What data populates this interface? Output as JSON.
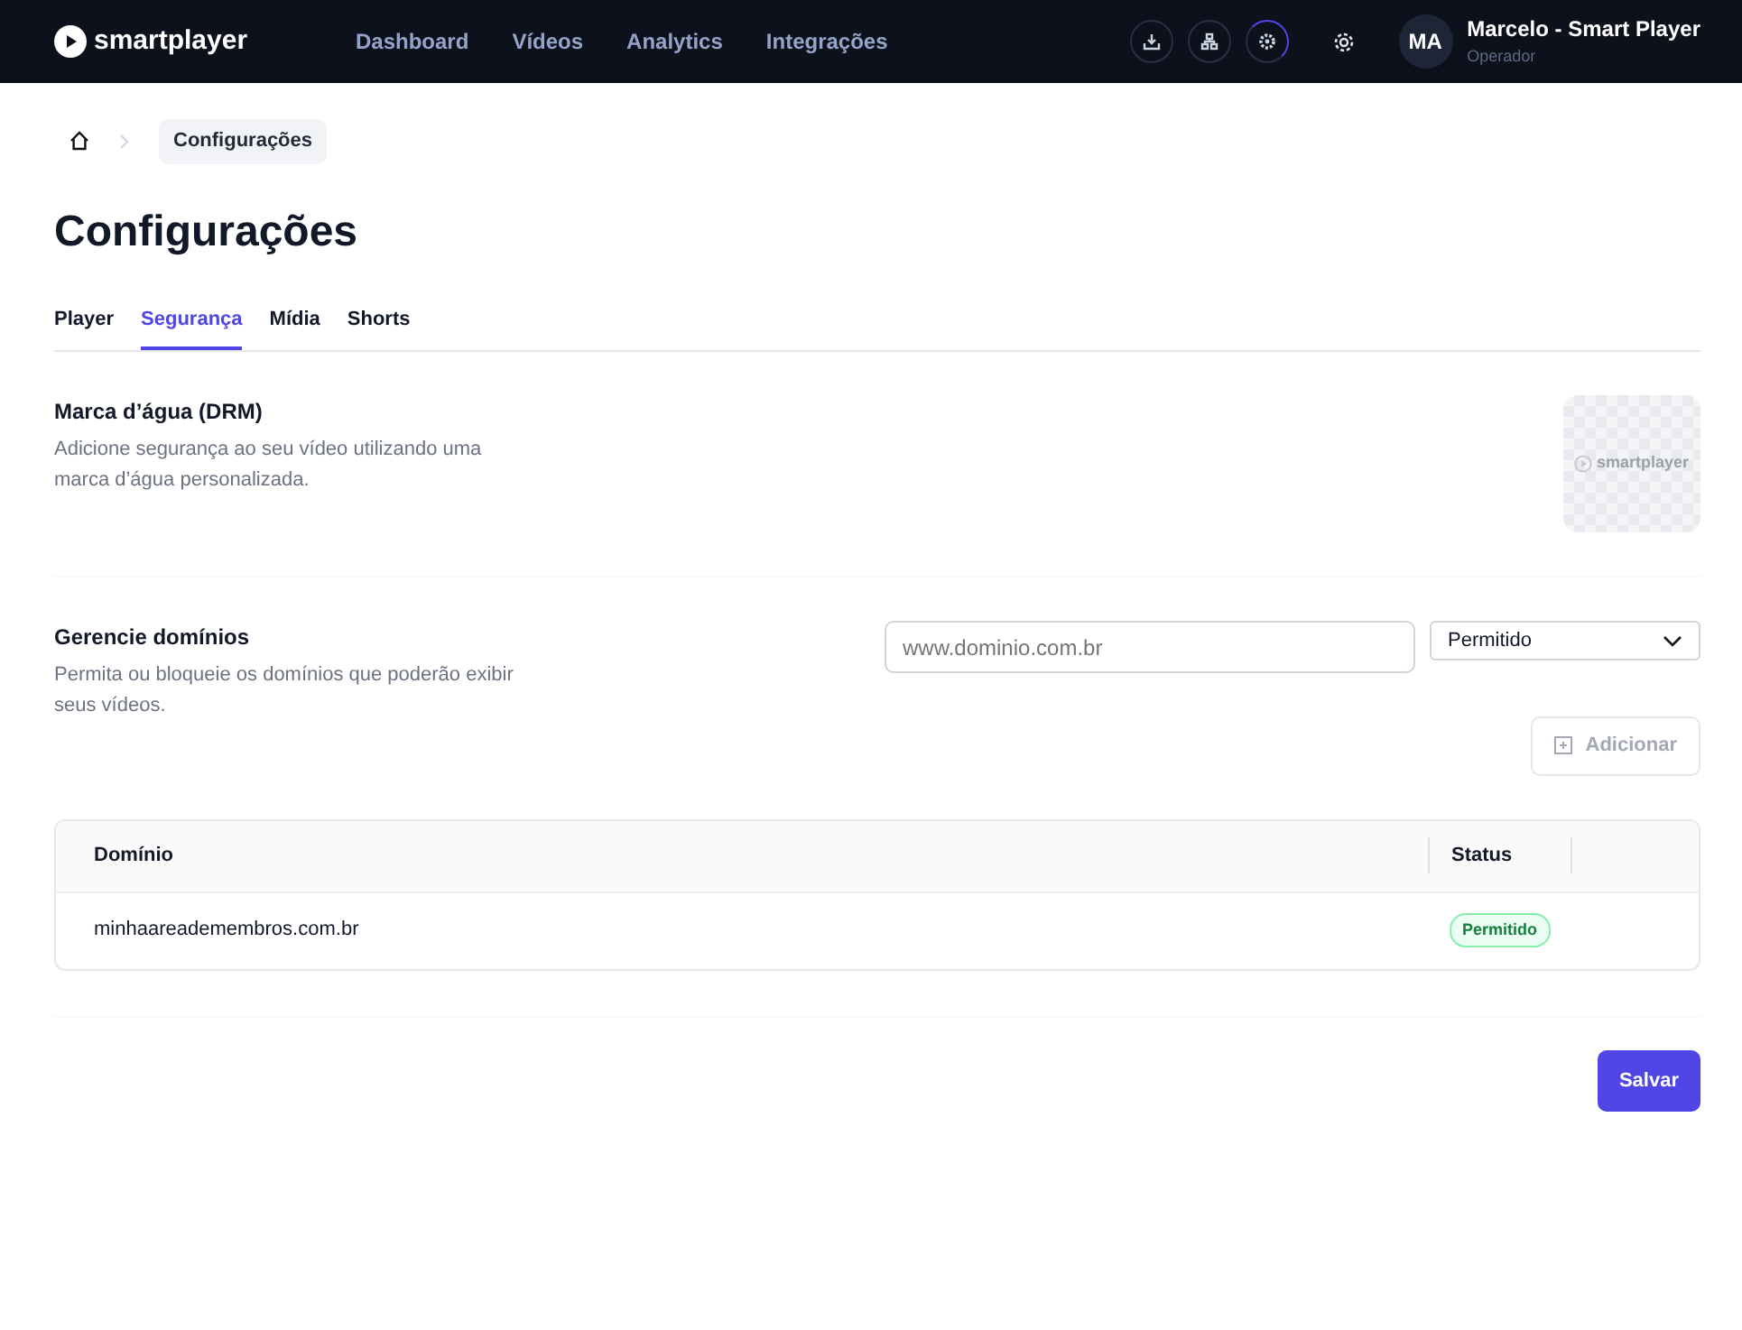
{
  "navbar": {
    "brand": "smartplayer",
    "links": [
      {
        "label": "Dashboard"
      },
      {
        "label": "Vídeos"
      },
      {
        "label": "Analytics"
      },
      {
        "label": "Integrações"
      }
    ],
    "user": {
      "initials": "MA",
      "name": "Marcelo - Smart Player",
      "role": "Operador"
    }
  },
  "breadcrumb": {
    "current": "Configurações"
  },
  "title": "Configurações",
  "tabs": [
    {
      "label": "Player",
      "selected": false
    },
    {
      "label": "Segurança",
      "selected": true
    },
    {
      "label": "Mídia",
      "selected": false
    },
    {
      "label": "Shorts",
      "selected": false
    }
  ],
  "watermark": {
    "title": "Marca d’água (DRM)",
    "description": "Adicione segurança ao seu vídeo utilizando uma marca d’água personalizada.",
    "preview_text": "smartplayer"
  },
  "domains": {
    "title": "Gerencie domínios",
    "description": "Permita ou bloqueie os domínios que poderão exibir seus vídeos.",
    "input": {
      "placeholder": "www.dominio.com.br"
    },
    "select": {
      "value": "Permitido"
    },
    "add_button": {
      "label": "Adicionar",
      "disabled": true
    },
    "table": {
      "columns": [
        "Domínio",
        "Status"
      ],
      "rows": [
        {
          "domain": "minhaareademembros.com.br",
          "status": "Permitido",
          "allowed": true
        }
      ]
    }
  },
  "save_button": "Salvar"
}
